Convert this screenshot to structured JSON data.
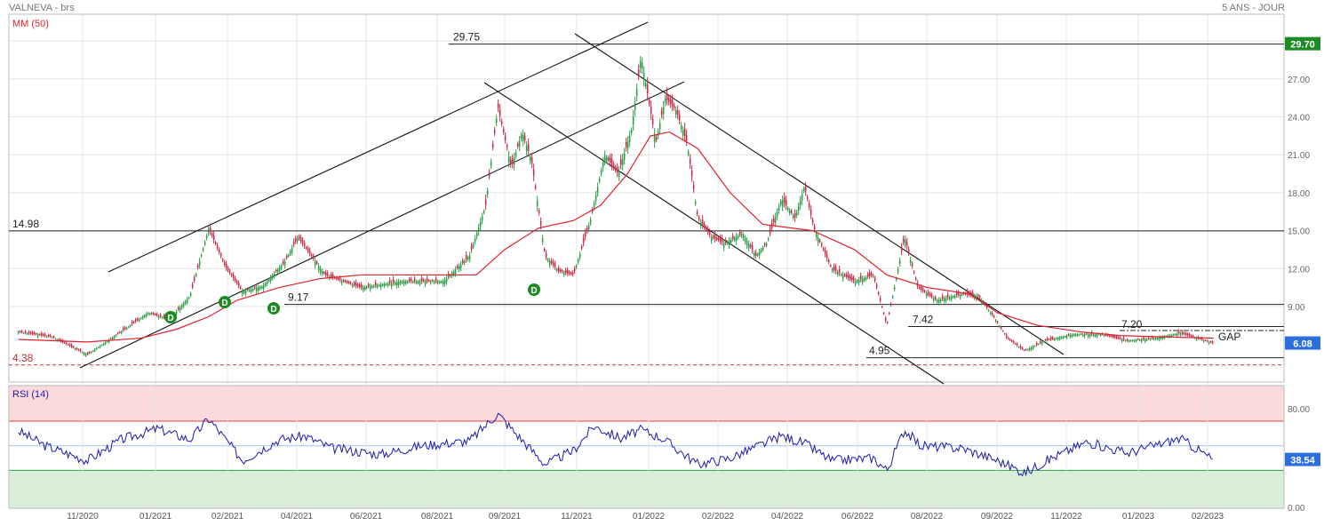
{
  "header": {
    "title": "VALNEVA - brs",
    "period": "5 ANS - JOUR"
  },
  "colors": {
    "up": "#2e9e48",
    "down": "#c0304a",
    "ma": "#e0202c",
    "rsi": "#1a1ab0",
    "overbought": "#fcd9da",
    "oversold": "#d9efd9",
    "grid": "#e4e4e4",
    "price_badge": "#2a6fdb",
    "top_badge": "#1e8a24",
    "dividend": "#1e8a24"
  },
  "chart_data": [
    {
      "type": "candlestick",
      "title": "VALNEVA - brs",
      "legend": [
        "MM (50)"
      ],
      "x_ticks": [
        "11/2020",
        "01/2021",
        "02/2021",
        "04/2021",
        "06/2021",
        "08/2021",
        "09/2021",
        "11/2021",
        "01/2022",
        "02/2022",
        "04/2022",
        "06/2022",
        "08/2022",
        "09/2022",
        "11/2022",
        "01/2023",
        "02/2023"
      ],
      "y_ticks": [
        9.0,
        12.0,
        15.0,
        18.0,
        21.0,
        24.0,
        27.0,
        30.0
      ],
      "ylim": [
        3.5,
        30.5
      ],
      "grid": true,
      "last_price": "6.08",
      "top_marker": "29.70",
      "price_series": [
        [
          "2020-09-20",
          7.0
        ],
        [
          "2020-10-15",
          6.6
        ],
        [
          "2020-11-10",
          5.2
        ],
        [
          "2020-12-05",
          7.0
        ],
        [
          "2020-12-25",
          8.5
        ],
        [
          "2021-01-10",
          8.0
        ],
        [
          "2021-01-25",
          9.8
        ],
        [
          "2021-02-08",
          15.2
        ],
        [
          "2021-02-20",
          12.2
        ],
        [
          "2021-03-05",
          10.2
        ],
        [
          "2021-03-20",
          10.6
        ],
        [
          "2021-04-05",
          12.5
        ],
        [
          "2021-04-15",
          14.5
        ],
        [
          "2021-05-05",
          11.5
        ],
        [
          "2021-06-01",
          10.5
        ],
        [
          "2021-07-01",
          11.0
        ],
        [
          "2021-08-01",
          11.0
        ],
        [
          "2021-08-20",
          13.0
        ],
        [
          "2021-09-01",
          17.0
        ],
        [
          "2021-09-10",
          24.8
        ],
        [
          "2021-09-20",
          20.0
        ],
        [
          "2021-09-28",
          22.8
        ],
        [
          "2021-10-05",
          20.5
        ],
        [
          "2021-10-15",
          13.0
        ],
        [
          "2021-10-25",
          11.8
        ],
        [
          "2021-11-05",
          11.5
        ],
        [
          "2021-11-18",
          16.0
        ],
        [
          "2021-11-28",
          21.0
        ],
        [
          "2021-12-08",
          19.5
        ],
        [
          "2021-12-18",
          23.0
        ],
        [
          "2021-12-25",
          28.8
        ],
        [
          "2022-01-05",
          22.0
        ],
        [
          "2022-01-12",
          25.5
        ],
        [
          "2022-01-20",
          24.5
        ],
        [
          "2022-01-28",
          22.0
        ],
        [
          "2022-02-05",
          16.0
        ],
        [
          "2022-02-15",
          14.5
        ],
        [
          "2022-02-25",
          14.0
        ],
        [
          "2022-03-10",
          14.8
        ],
        [
          "2022-03-20",
          13.0
        ],
        [
          "2022-03-28",
          14.0
        ],
        [
          "2022-04-08",
          17.5
        ],
        [
          "2022-04-18",
          16.0
        ],
        [
          "2022-04-25",
          18.5
        ],
        [
          "2022-05-02",
          15.2
        ],
        [
          "2022-05-15",
          12.0
        ],
        [
          "2022-06-01",
          11.0
        ],
        [
          "2022-06-15",
          11.5
        ],
        [
          "2022-06-25",
          7.5
        ],
        [
          "2022-07-08",
          14.5
        ],
        [
          "2022-07-18",
          10.5
        ],
        [
          "2022-08-01",
          9.5
        ],
        [
          "2022-08-20",
          10.0
        ],
        [
          "2022-09-01",
          9.8
        ],
        [
          "2022-09-12",
          8.2
        ],
        [
          "2022-09-22",
          6.5
        ],
        [
          "2022-10-05",
          5.5
        ],
        [
          "2022-10-20",
          6.3
        ],
        [
          "2022-11-10",
          6.8
        ],
        [
          "2022-12-01",
          6.8
        ],
        [
          "2022-12-20",
          6.3
        ],
        [
          "2023-01-10",
          6.5
        ],
        [
          "2023-01-28",
          6.9
        ],
        [
          "2023-02-10",
          6.5
        ],
        [
          "2023-02-22",
          6.08
        ]
      ],
      "moving_average": [
        [
          "2020-09-20",
          6.4
        ],
        [
          "2020-11-10",
          6.2
        ],
        [
          "2020-12-20",
          6.5
        ],
        [
          "2021-01-15",
          7.2
        ],
        [
          "2021-02-08",
          8.2
        ],
        [
          "2021-03-01",
          9.5
        ],
        [
          "2021-04-01",
          10.5
        ],
        [
          "2021-05-01",
          11.2
        ],
        [
          "2021-06-01",
          11.5
        ],
        [
          "2021-07-15",
          11.5
        ],
        [
          "2021-08-25",
          11.5
        ],
        [
          "2021-09-15",
          13.5
        ],
        [
          "2021-10-10",
          15.2
        ],
        [
          "2021-11-05",
          15.8
        ],
        [
          "2021-11-25",
          17.0
        ],
        [
          "2021-12-15",
          19.5
        ],
        [
          "2022-01-01",
          22.5
        ],
        [
          "2022-01-15",
          22.8
        ],
        [
          "2022-02-05",
          21.5
        ],
        [
          "2022-03-01",
          18.0
        ],
        [
          "2022-03-25",
          15.5
        ],
        [
          "2022-05-01",
          15.0
        ],
        [
          "2022-06-01",
          13.5
        ],
        [
          "2022-06-25",
          11.5
        ],
        [
          "2022-07-25",
          10.5
        ],
        [
          "2022-08-25",
          10.0
        ],
        [
          "2022-09-15",
          8.5
        ],
        [
          "2022-10-15",
          7.5
        ],
        [
          "2022-11-15",
          7.0
        ],
        [
          "2022-12-15",
          6.7
        ],
        [
          "2023-01-15",
          6.6
        ],
        [
          "2023-02-22",
          6.5
        ]
      ],
      "support_resistance": [
        {
          "label": "29.75",
          "value": 29.75
        },
        {
          "label": "14.98",
          "value": 14.98
        },
        {
          "label": "9.17",
          "value": 9.17
        },
        {
          "label": "7.42",
          "value": 7.42
        },
        {
          "label": "4.95",
          "value": 4.95
        },
        {
          "label": "4.38",
          "value": 4.38
        }
      ],
      "annotations": [
        "7.20",
        "GAP"
      ],
      "dividend_markers": [
        "D",
        "D",
        "D",
        "D"
      ]
    },
    {
      "type": "line",
      "title": "RSI (14)",
      "y_ticks": [
        0.0,
        80.0
      ],
      "ylim": [
        0,
        100
      ],
      "overbought": 70,
      "oversold": 30,
      "last_value": "38.54",
      "rsi_series": [
        [
          "2020-09-20",
          62
        ],
        [
          "2020-10-10",
          50
        ],
        [
          "2020-11-10",
          38
        ],
        [
          "2020-12-05",
          55
        ],
        [
          "2021-01-01",
          64
        ],
        [
          "2021-01-25",
          55
        ],
        [
          "2021-02-08",
          72
        ],
        [
          "2021-03-05",
          38
        ],
        [
          "2021-04-01",
          55
        ],
        [
          "2021-04-20",
          58
        ],
        [
          "2021-05-10",
          48
        ],
        [
          "2021-06-15",
          43
        ],
        [
          "2021-07-15",
          50
        ],
        [
          "2021-08-20",
          54
        ],
        [
          "2021-09-10",
          76
        ],
        [
          "2021-09-25",
          58
        ],
        [
          "2021-10-15",
          35
        ],
        [
          "2021-11-05",
          46
        ],
        [
          "2021-11-20",
          66
        ],
        [
          "2021-12-10",
          56
        ],
        [
          "2021-12-25",
          63
        ],
        [
          "2022-01-10",
          56
        ],
        [
          "2022-02-05",
          35
        ],
        [
          "2022-03-01",
          40
        ],
        [
          "2022-04-08",
          58
        ],
        [
          "2022-04-25",
          52
        ],
        [
          "2022-05-15",
          38
        ],
        [
          "2022-06-15",
          40
        ],
        [
          "2022-06-25",
          30
        ],
        [
          "2022-07-08",
          63
        ],
        [
          "2022-07-20",
          50
        ],
        [
          "2022-08-20",
          48
        ],
        [
          "2022-09-15",
          38
        ],
        [
          "2022-10-05",
          28
        ],
        [
          "2022-10-25",
          40
        ],
        [
          "2022-11-20",
          53
        ],
        [
          "2022-12-20",
          44
        ],
        [
          "2023-01-28",
          56
        ],
        [
          "2023-02-22",
          38.54
        ]
      ]
    }
  ]
}
